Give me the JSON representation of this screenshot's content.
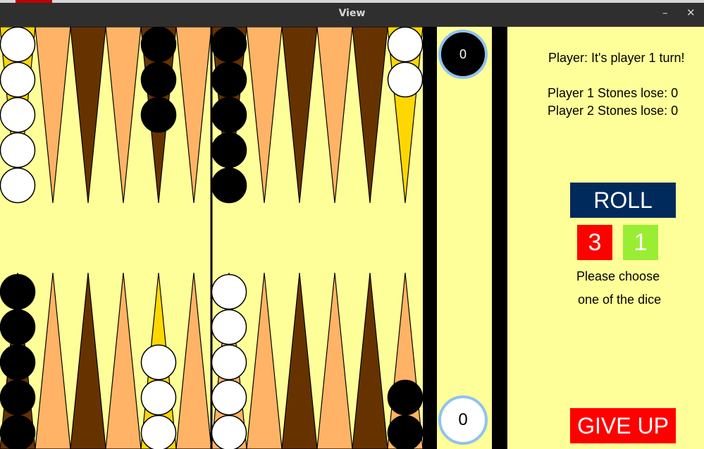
{
  "window": {
    "title": "View",
    "minimize_glyph": "–",
    "close_glyph": "✕"
  },
  "colors": {
    "board_bg": "#ffff99",
    "point_light": "#ffb366",
    "point_dark": "#663300",
    "point_highlight": "#ffd700",
    "checker_white": "#ffffff",
    "checker_black": "#000000",
    "roll_button": "#002a5c",
    "die_1": "#ff0000",
    "die_2": "#99ee33",
    "give_up_button": "#ff0000",
    "counter_ring": "#8fc3f0"
  },
  "board": {
    "top_points": [
      {
        "color": "highlight",
        "checkers": 5,
        "checker_color": "white"
      },
      {
        "color": "light",
        "checkers": 0,
        "checker_color": ""
      },
      {
        "color": "dark",
        "checkers": 0,
        "checker_color": ""
      },
      {
        "color": "light",
        "checkers": 0,
        "checker_color": ""
      },
      {
        "color": "dark",
        "checkers": 3,
        "checker_color": "black"
      },
      {
        "color": "light",
        "checkers": 0,
        "checker_color": ""
      },
      {
        "color": "dark",
        "checkers": 5,
        "checker_color": "black"
      },
      {
        "color": "light",
        "checkers": 0,
        "checker_color": ""
      },
      {
        "color": "dark",
        "checkers": 0,
        "checker_color": ""
      },
      {
        "color": "light",
        "checkers": 0,
        "checker_color": ""
      },
      {
        "color": "dark",
        "checkers": 0,
        "checker_color": ""
      },
      {
        "color": "highlight",
        "checkers": 2,
        "checker_color": "white"
      }
    ],
    "bottom_points": [
      {
        "color": "dark",
        "checkers": 5,
        "checker_color": "black"
      },
      {
        "color": "light",
        "checkers": 0,
        "checker_color": ""
      },
      {
        "color": "dark",
        "checkers": 0,
        "checker_color": ""
      },
      {
        "color": "light",
        "checkers": 0,
        "checker_color": ""
      },
      {
        "color": "highlight",
        "checkers": 3,
        "checker_color": "white"
      },
      {
        "color": "light",
        "checkers": 0,
        "checker_color": ""
      },
      {
        "color": "light",
        "checkers": 5,
        "checker_color": "white"
      },
      {
        "color": "light",
        "checkers": 0,
        "checker_color": ""
      },
      {
        "color": "dark",
        "checkers": 0,
        "checker_color": ""
      },
      {
        "color": "light",
        "checkers": 0,
        "checker_color": ""
      },
      {
        "color": "dark",
        "checkers": 0,
        "checker_color": ""
      },
      {
        "color": "light",
        "checkers": 2,
        "checker_color": "black"
      }
    ]
  },
  "bar": {
    "black_count": "0",
    "white_count": "0"
  },
  "status": {
    "turn_text": "Player: It's player 1 turn!",
    "p1_lost": "Player 1 Stones lose: 0",
    "p2_lost": "Player 2 Stones lose: 0",
    "instruction_line1": "Please choose",
    "instruction_line2": "one of the dice"
  },
  "controls": {
    "roll_label": "ROLL",
    "die1": "3",
    "die2": "1",
    "give_up_label": "GIVE UP"
  }
}
